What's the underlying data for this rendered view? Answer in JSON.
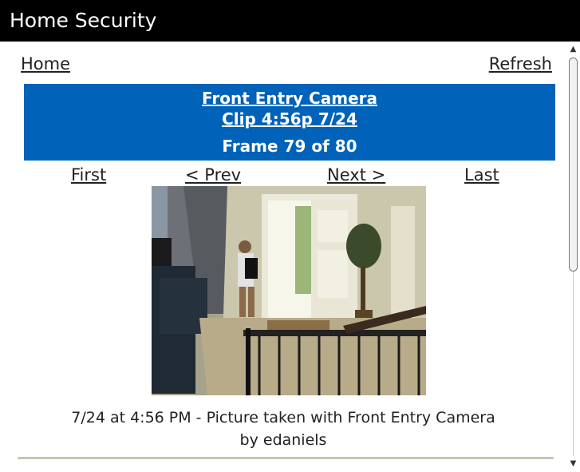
{
  "window": {
    "title": "Home Security"
  },
  "toplinks": {
    "home": "Home",
    "refresh": "Refresh"
  },
  "banner": {
    "camera": "Front Entry Camera",
    "clip": "Clip 4:56p 7/24",
    "frame": "Frame 79 of 80"
  },
  "nav": {
    "first": "First",
    "prev": "< Prev",
    "next": "Next >",
    "last": "Last"
  },
  "caption": {
    "line1": "7/24 at 4:56 PM - Picture taken with Front Entry Camera",
    "line2": "by edaniels"
  },
  "colors": {
    "titlebar_bg": "#000000",
    "banner_bg": "#0062b8"
  },
  "icons": {
    "scroll_up": "arrow-up-icon",
    "scroll_down": "arrow-down-icon"
  }
}
